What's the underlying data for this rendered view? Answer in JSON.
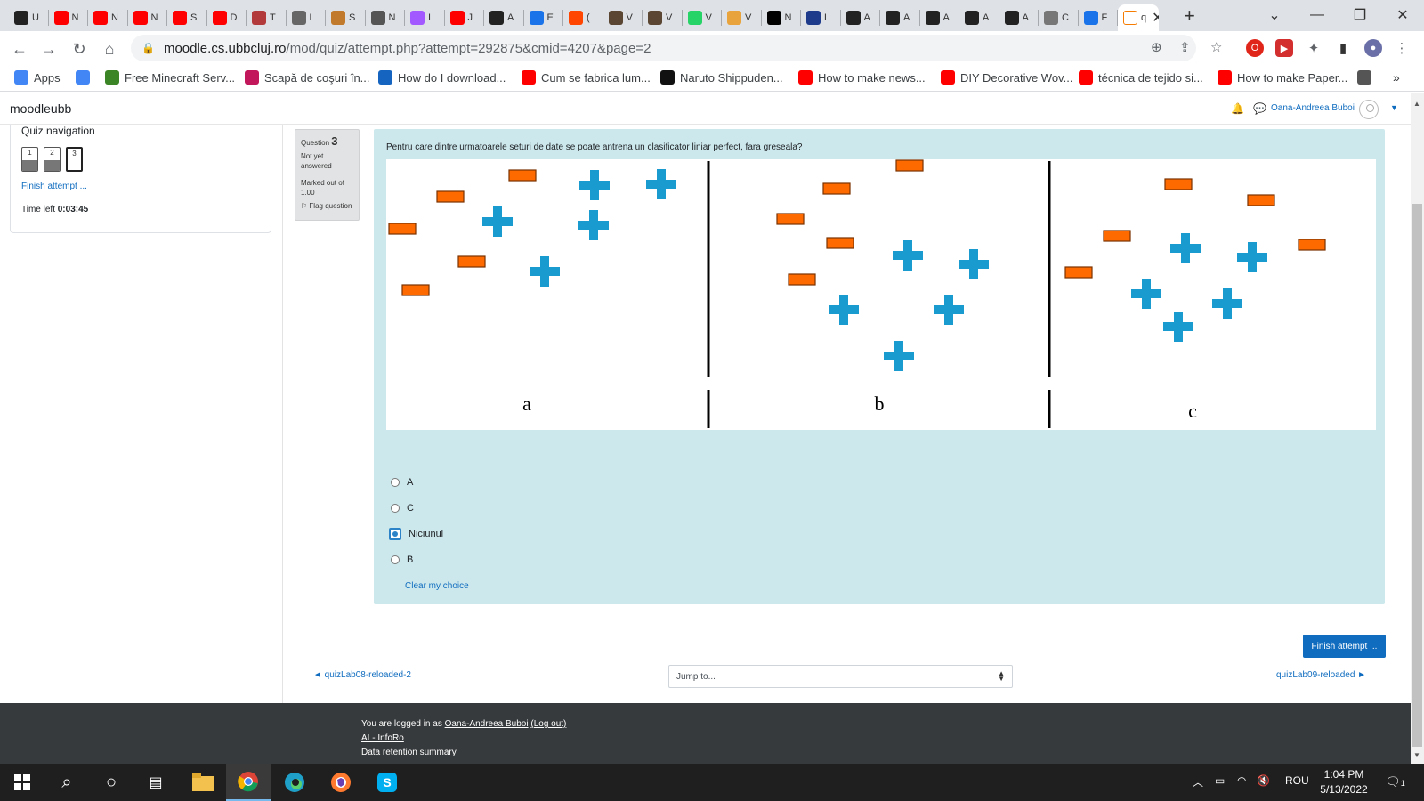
{
  "browser": {
    "tabs": [
      {
        "icon": "app-tab-icon",
        "label": "U",
        "color": "#222222"
      },
      {
        "icon": "youtube-icon",
        "label": "N",
        "color": "#ff0000"
      },
      {
        "icon": "youtube-icon",
        "label": "N",
        "color": "#ff0000"
      },
      {
        "icon": "youtube-icon",
        "label": "N",
        "color": "#ff0000"
      },
      {
        "icon": "youtube-icon",
        "label": "S",
        "color": "#ff0000"
      },
      {
        "icon": "youtube-icon",
        "label": "D",
        "color": "#ff0000"
      },
      {
        "icon": "k-site-icon",
        "label": "T",
        "color": "#b23a3a"
      },
      {
        "icon": "github-site-icon",
        "label": "L",
        "color": "#666666"
      },
      {
        "icon": "dog-site-icon",
        "label": "S",
        "color": "#c17a2b"
      },
      {
        "icon": "globe-icon",
        "label": "N",
        "color": "#555555"
      },
      {
        "icon": "figma-icon",
        "label": "I",
        "color": "#a259ff"
      },
      {
        "icon": "youtube-icon",
        "label": "J",
        "color": "#ff0000"
      },
      {
        "icon": "github-icon",
        "label": "A",
        "color": "#222222"
      },
      {
        "icon": "star-icon",
        "label": "E",
        "color": "#1a73e8"
      },
      {
        "icon": "reddit-icon",
        "label": "(",
        "color": "#ff4500"
      },
      {
        "icon": "box-icon",
        "label": "V",
        "color": "#5a4632"
      },
      {
        "icon": "box-icon",
        "label": "V",
        "color": "#5a4632"
      },
      {
        "icon": "whatsapp-icon",
        "label": "V",
        "color": "#25d366"
      },
      {
        "icon": "pen-site-icon",
        "label": "V",
        "color": "#e8a33d"
      },
      {
        "icon": "medium-icon",
        "label": "N",
        "color": "#000000"
      },
      {
        "icon": "circle-site-icon",
        "label": "L",
        "color": "#1e3a8a"
      },
      {
        "icon": "github-icon",
        "label": "A",
        "color": "#222222"
      },
      {
        "icon": "github-icon",
        "label": "A",
        "color": "#222222"
      },
      {
        "icon": "github-icon",
        "label": "A",
        "color": "#222222"
      },
      {
        "icon": "github-icon",
        "label": "A",
        "color": "#222222"
      },
      {
        "icon": "github-icon",
        "label": "A",
        "color": "#222222"
      },
      {
        "icon": "chrome-gray-icon",
        "label": "C",
        "color": "#777777"
      },
      {
        "icon": "k-blue-icon",
        "label": "F",
        "color": "#1a73e8"
      },
      {
        "icon": "moodle-tab-icon",
        "label": "q",
        "color": "#ffffff",
        "active": true
      }
    ],
    "new_tab": "+",
    "window_controls": {
      "minimize": "—",
      "restore": "❐",
      "close": "✕",
      "dropdown": "⌄"
    },
    "url_host": "moodle.cs.ubbcluj.ro",
    "url_path": "/mod/quiz/attempt.php?attempt=292875&cmid=4207&page=2",
    "bookmarks": [
      {
        "icon": "apps-grid-icon",
        "label": "Apps",
        "color": "#4285f4"
      },
      {
        "icon": "google-icon",
        "label": "",
        "color": "#4285f4"
      },
      {
        "icon": "minecraft-icon",
        "label": "Free Minecraft Serv...",
        "color": "#3c8527"
      },
      {
        "icon": "stripes-icon",
        "label": "Scapă de coşuri în...",
        "color": "#c2185b"
      },
      {
        "icon": "question-icon",
        "label": "How do I download...",
        "color": "#1565c0"
      },
      {
        "icon": "youtube-icon",
        "label": "Cum se fabrica lum...",
        "color": "#ff0000"
      },
      {
        "icon": "ak-icon",
        "label": "Naruto Shippuden...",
        "color": "#111111"
      },
      {
        "icon": "youtube-icon",
        "label": "How to make news...",
        "color": "#ff0000"
      },
      {
        "icon": "youtube-icon",
        "label": "DIY Decorative Wov...",
        "color": "#ff0000"
      },
      {
        "icon": "youtube-icon",
        "label": "técnica de tejido si...",
        "color": "#ff0000"
      },
      {
        "icon": "youtube-icon",
        "label": "How to make Paper...",
        "color": "#ff0000"
      },
      {
        "icon": "globe-icon",
        "label": "",
        "color": "#555555"
      }
    ],
    "bookmarks_more": "»"
  },
  "moodle": {
    "brand": "moodleubb",
    "user_name": "Oana-Andreea Buboi"
  },
  "quiz_nav": {
    "title": "Quiz navigation",
    "buttons": [
      {
        "number": "1",
        "answered": true,
        "current": false
      },
      {
        "number": "2",
        "answered": true,
        "current": false
      },
      {
        "number": "3",
        "answered": false,
        "current": true
      }
    ],
    "finish_link": "Finish attempt ...",
    "time_left_label": "Time left",
    "time_left_value": "0:03:45"
  },
  "question": {
    "label": "Question",
    "number": "3",
    "state": "Not yet answered",
    "grade": "Marked out of 1.00",
    "flag": "Flag question",
    "text": "Pentru care dintre urmatoarele seturi de date se poate antrena un clasificator liniar perfect, fara greseala?",
    "image_panel_labels": [
      "a",
      "b",
      "c"
    ],
    "colors": {
      "minus": "#ff6a00",
      "plus": "#1a9bd0",
      "background": "#cde8ec"
    },
    "options": [
      {
        "label": "A",
        "checked": false
      },
      {
        "label": "C",
        "checked": false
      },
      {
        "label": "Niciunul",
        "checked": true
      },
      {
        "label": "B",
        "checked": false
      }
    ],
    "clear_choice": "Clear my choice"
  },
  "page_nav": {
    "finish_button": "Finish attempt ...",
    "prev_link": "◄ quizLab08-reloaded-2",
    "jump_placeholder": "Jump to...",
    "next_link": "quizLab09-reloaded ►"
  },
  "footer": {
    "logged_in_prefix": "You are logged in as",
    "user_name": "Oana-Andreea Buboi",
    "logout": "(Log out)",
    "link1": "AI - InfoRo",
    "link2": "Data retention summary"
  },
  "taskbar": {
    "language": "ROU",
    "time": "1:04 PM",
    "date": "5/13/2022",
    "notification_count": "1"
  }
}
